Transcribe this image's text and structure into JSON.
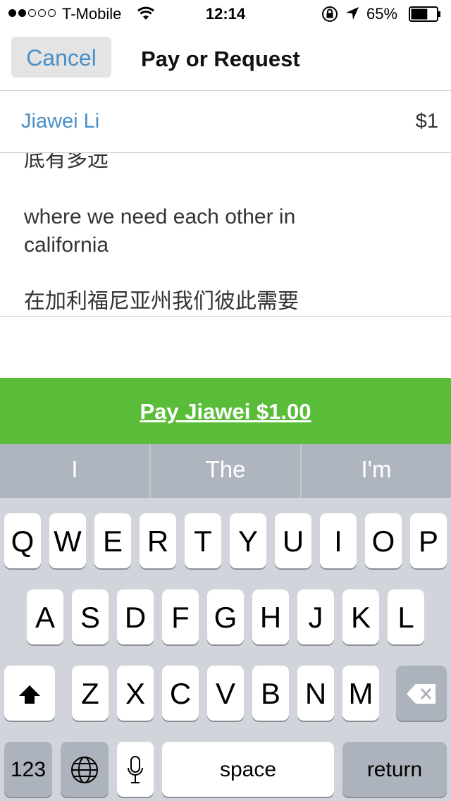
{
  "status_bar": {
    "carrier": "T-Mobile",
    "signal_bars_filled": 2,
    "signal_bars_total": 5,
    "time": "12:14",
    "battery_percent_text": "65%",
    "battery_level": 0.65
  },
  "nav": {
    "cancel_label": "Cancel",
    "title": "Pay or Request"
  },
  "transaction": {
    "recipient": "Jiawei Li",
    "amount": "$1"
  },
  "note": {
    "line1": "底有多远",
    "line2": "where we need each other in",
    "line3": "california",
    "line4": "在加利福尼亚州我们彼此需要"
  },
  "pay_button": {
    "label": "Pay Jiawei $1.00"
  },
  "predictions": [
    "I",
    "The",
    "I'm"
  ],
  "keyboard": {
    "row1": [
      "Q",
      "W",
      "E",
      "R",
      "T",
      "Y",
      "U",
      "I",
      "O",
      "P"
    ],
    "row2": [
      "A",
      "S",
      "D",
      "F",
      "G",
      "H",
      "J",
      "K",
      "L"
    ],
    "row3": [
      "Z",
      "X",
      "C",
      "V",
      "B",
      "N",
      "M"
    ],
    "numbers_label": "123",
    "space_label": "space",
    "return_label": "return"
  },
  "colors": {
    "accent_blue": "#4a90c8",
    "pay_green": "#5abd3a",
    "keyboard_bg": "#d1d5db"
  },
  "icons": [
    "wifi-icon",
    "rotation-lock-icon",
    "location-arrow-icon",
    "battery-icon",
    "shift-icon",
    "backspace-icon",
    "globe-icon",
    "microphone-icon"
  ]
}
